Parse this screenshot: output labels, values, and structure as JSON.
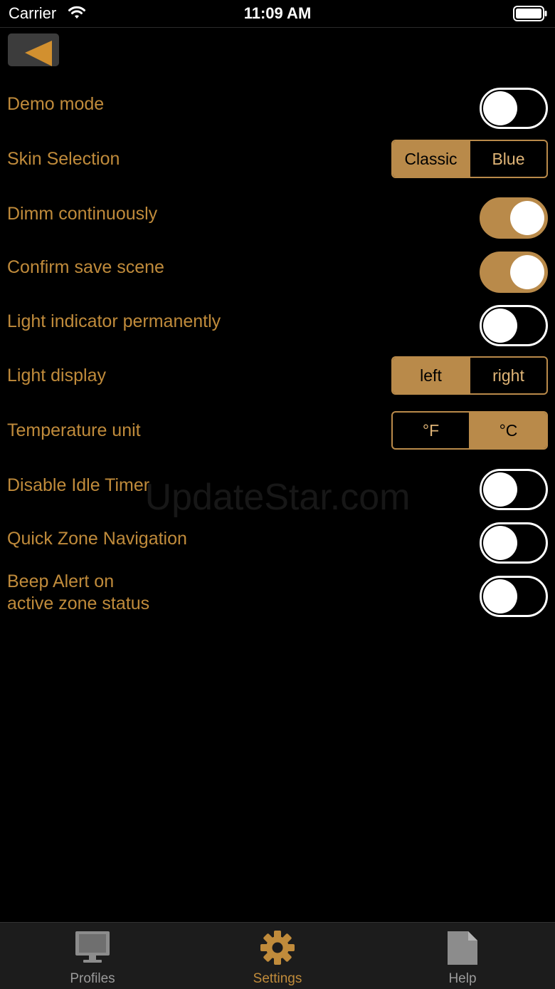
{
  "status": {
    "carrier": "Carrier",
    "time": "11:09 AM"
  },
  "colors": {
    "accent": "#b98a4a",
    "label": "#c08b3b",
    "background": "#000000"
  },
  "watermark": "UpdateStar.com",
  "settings": [
    {
      "label": "Demo mode",
      "type": "toggle",
      "on": false
    },
    {
      "label": "Skin Selection",
      "type": "segmented",
      "options": [
        "Classic",
        "Blue"
      ],
      "selected": 0
    },
    {
      "label": "Dimm continuously",
      "type": "toggle",
      "on": true
    },
    {
      "label": "Confirm save scene",
      "type": "toggle",
      "on": true
    },
    {
      "label": "Light indicator permanently",
      "type": "toggle",
      "on": false
    },
    {
      "label": "Light display",
      "type": "segmented",
      "options": [
        "left",
        "right"
      ],
      "selected": 0
    },
    {
      "label": "Temperature unit",
      "type": "segmented",
      "options": [
        "°F",
        "°C"
      ],
      "selected": 1
    },
    {
      "label": "Disable Idle Timer",
      "type": "toggle",
      "on": false
    },
    {
      "label": "Quick Zone Navigation",
      "type": "toggle",
      "on": false
    },
    {
      "label_line1": "Beep Alert on",
      "label_line2": "active zone status",
      "type": "toggle",
      "on": false
    }
  ],
  "tabs": [
    {
      "label": "Profiles",
      "icon": "monitor-icon"
    },
    {
      "label": "Settings",
      "icon": "gear-icon"
    },
    {
      "label": "Help",
      "icon": "document-icon"
    }
  ],
  "active_tab": 1
}
